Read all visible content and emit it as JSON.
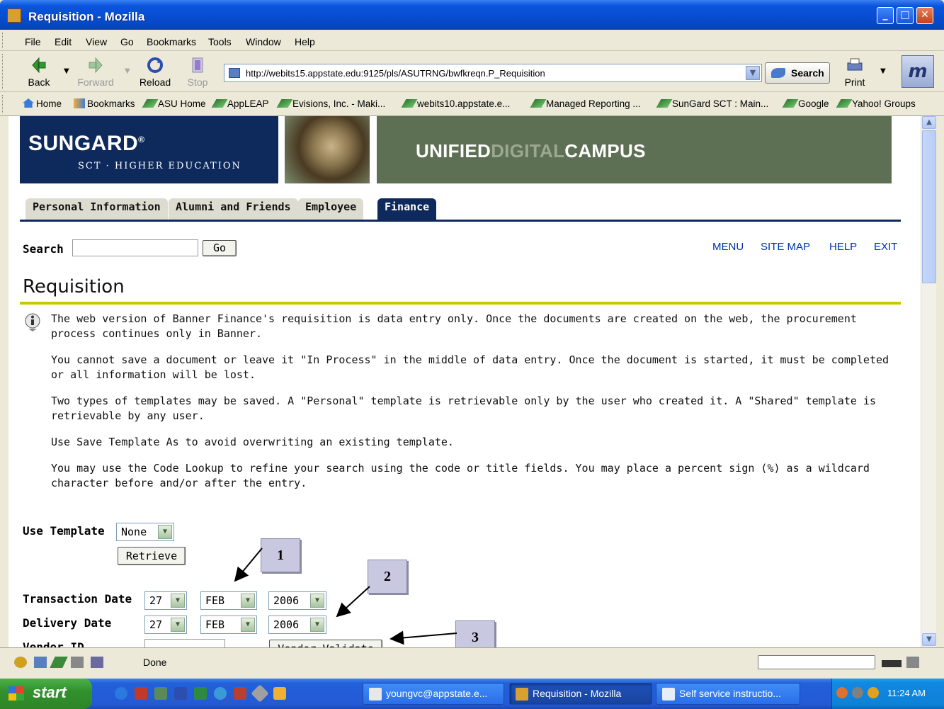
{
  "window": {
    "title": "Requisition - Mozilla"
  },
  "menu": [
    "File",
    "Edit",
    "View",
    "Go",
    "Bookmarks",
    "Tools",
    "Window",
    "Help"
  ],
  "nav": {
    "back": "Back",
    "forward": "Forward",
    "reload": "Reload",
    "stop": "Stop",
    "print": "Print",
    "search": "Search"
  },
  "address": {
    "url": "http://webits15.appstate.edu:9125/pls/ASUTRNG/bwfkreqn.P_Requisition"
  },
  "bookmarks": [
    "Home",
    "Bookmarks",
    "ASU Home",
    "AppLEAP",
    "Evisions, Inc. - Maki...",
    "webits10.appstate.e...",
    "Managed Reporting ...",
    "SunGard SCT : Main...",
    "Google",
    "Yahoo! Groups"
  ],
  "banner": {
    "brand": "SUNGARD",
    "reg": "®",
    "sub": "SCT · HIGHER EDUCATION",
    "udc_a": "UNIFIED",
    "udc_b": "DIGITAL",
    "udc_c": "CAMPUS"
  },
  "tabs": [
    "Personal Information",
    "Alumni and Friends",
    "Employee",
    "Finance"
  ],
  "search": {
    "label": "Search",
    "go": "Go"
  },
  "toplinks": [
    "MENU",
    "SITE MAP",
    "HELP",
    "EXIT"
  ],
  "page": {
    "title": "Requisition",
    "info": [
      "The web version of Banner Finance's requisition is data entry only. Once the documents are created on the web, the procurement process continues only in Banner.",
      "You cannot save a document or leave it \"In Process\" in the middle of data entry. Once the document is started, it must be completed or all information will be lost.",
      "Two types of templates may be saved. A \"Personal\" template is retrievable only by the user who created it. A \"Shared\" template is retrievable by any user.",
      "Use Save Template As to avoid overwriting an existing template.",
      "You may use the Code Lookup to refine your search using the code or title fields. You may place a percent sign (%) as a wildcard character before and/or after the entry."
    ]
  },
  "form": {
    "use_template": "Use Template",
    "template_value": "None",
    "retrieve": "Retrieve",
    "transaction_date": "Transaction Date",
    "delivery_date": "Delivery Date",
    "vendor_id": "Vendor ID",
    "tx_day": "27",
    "tx_month": "FEB",
    "tx_year": "2006",
    "dl_day": "27",
    "dl_month": "FEB",
    "dl_year": "2006",
    "vendor_validate": "Vendor Validate"
  },
  "callouts": [
    "1",
    "2",
    "3"
  ],
  "status": {
    "text": "Done"
  },
  "taskbar": {
    "start": "start",
    "tasks": [
      "youngvc@appstate.e...",
      "Requisition - Mozilla",
      "Self service instructio..."
    ],
    "clock": "11:24 AM"
  }
}
